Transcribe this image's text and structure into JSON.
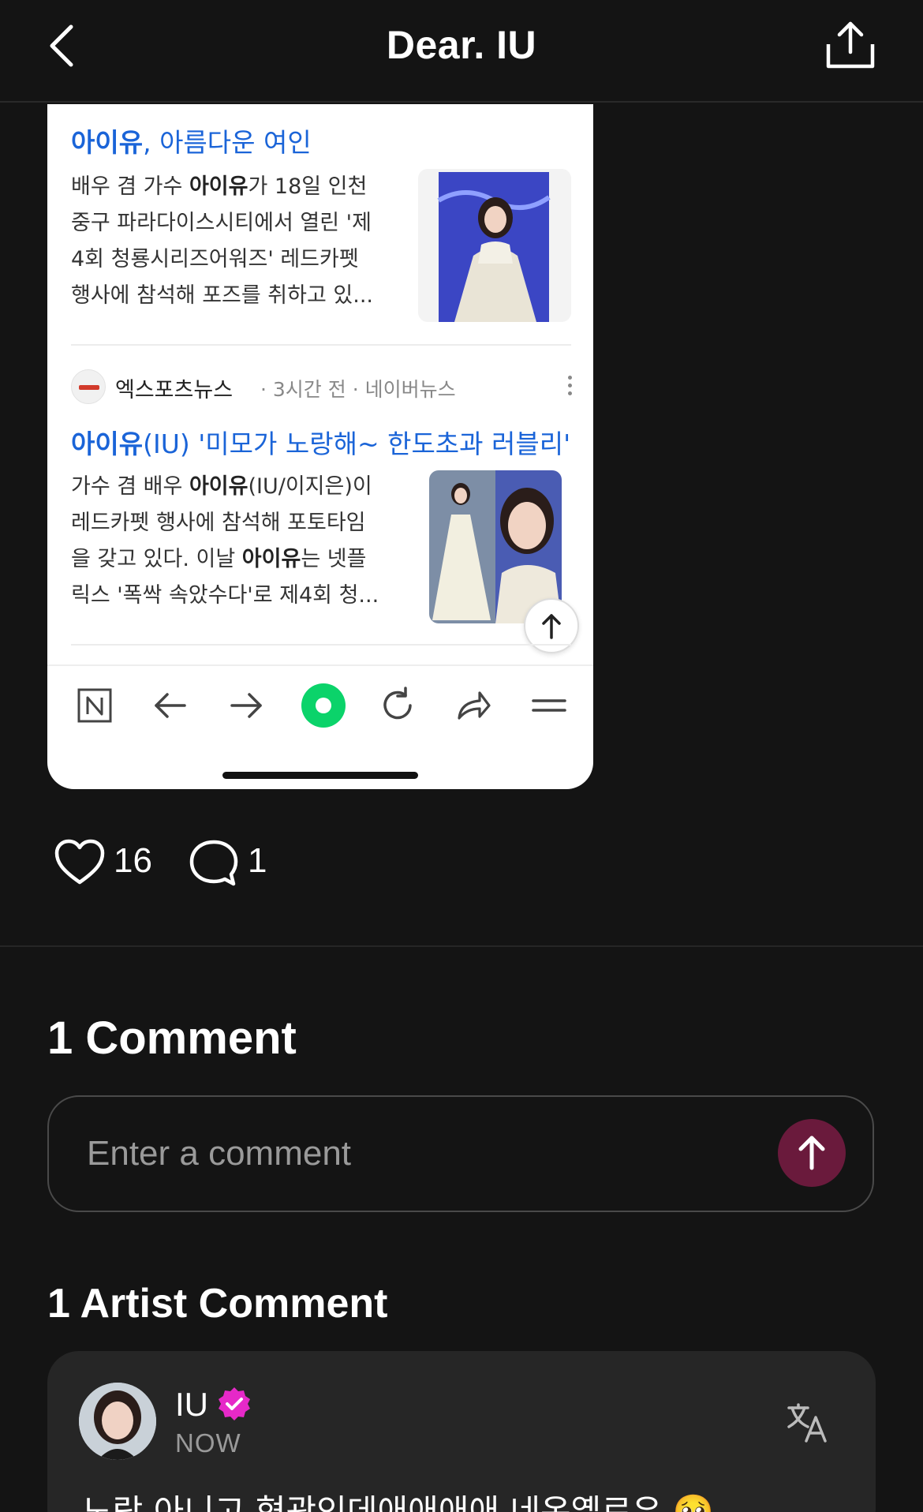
{
  "header": {
    "title": "Dear. IU"
  },
  "card": {
    "article1": {
      "title_bold": "아이유",
      "title_rest": ", 아름다운 여인",
      "body_lines": [
        [
          "배우 겸 가수 ",
          "아이유",
          "가 18일 인천"
        ],
        [
          "중구 파라다이스시티에서 열린 '제",
          "",
          ""
        ],
        [
          "4회 청룡시리즈어워즈' 레드카펫",
          "",
          ""
        ],
        [
          "행사에 참석해 포즈를 취하고 있...",
          "",
          ""
        ]
      ]
    },
    "source": {
      "name": "엑스포츠뉴스",
      "meta": "· 3시간 전 · 네이버뉴스"
    },
    "article2": {
      "title_bold": "아이유",
      "title_rest": "(IU) '미모가 노랑해~ 한도초과 러블리'",
      "body_lines": [
        [
          "가수 겸 배우 ",
          "아이유",
          "(IU/이지은)이"
        ],
        [
          "레드카펫 행사에 참석해 포토타임",
          "",
          ""
        ],
        [
          "을 갖고 있다. 이날 ",
          "아이유",
          "는 넷플"
        ],
        [
          "릭스 '폭싹 속았수다'로 제4회 청...",
          "",
          ""
        ]
      ]
    },
    "toolbar": [
      "N-icon",
      "back-arrow-icon",
      "forward-arrow-icon",
      "green-dot-icon",
      "refresh-icon",
      "share-icon",
      "menu-icon"
    ]
  },
  "reactions": {
    "likes": "16",
    "comments": "1"
  },
  "comments": {
    "heading": "1 Comment",
    "input_placeholder": "Enter a comment",
    "artist_heading": "1 Artist Comment"
  },
  "artist_comment": {
    "name": "IU",
    "time": "NOW",
    "text": "노랑 아니고 형광인데애애애애 네온옐로우 🥺"
  },
  "colors": {
    "accent": "#6a1a3c",
    "link_blue": "#1a64d8",
    "verified": "#e629c8",
    "naver_green": "#03c75a"
  }
}
